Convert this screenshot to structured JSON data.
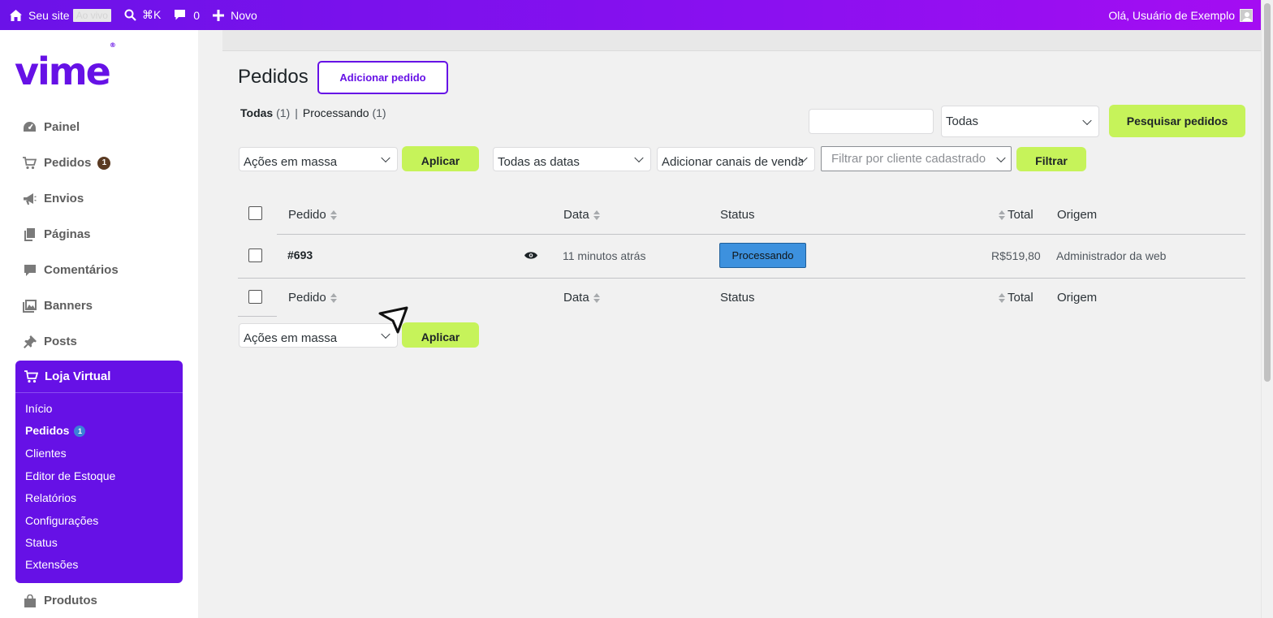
{
  "adminbar": {
    "site_label": "Seu site",
    "live_label": "Ao vivo",
    "search_shortcut": "⌘K",
    "comments_count": "0",
    "new_label": "Novo",
    "greeting": "Olá, Usuário de Exemplo"
  },
  "brand": {
    "logo": "vime",
    "registered": "®",
    "accent": "#6611e6"
  },
  "sidebar": {
    "items": [
      {
        "label": "Painel",
        "icon": "dashboard-icon"
      },
      {
        "label": "Pedidos",
        "icon": "cart-icon",
        "badge": "1"
      },
      {
        "label": "Envios",
        "icon": "megaphone-icon"
      },
      {
        "label": "Páginas",
        "icon": "pages-icon"
      },
      {
        "label": "Comentários",
        "icon": "comment-icon"
      },
      {
        "label": "Banners",
        "icon": "media-icon"
      },
      {
        "label": "Posts",
        "icon": "pin-icon"
      }
    ],
    "store": {
      "title": "Loja Virtual",
      "subitems": [
        {
          "label": "Início"
        },
        {
          "label": "Pedidos",
          "badge": "1"
        },
        {
          "label": "Clientes"
        },
        {
          "label": "Editor de Estoque"
        },
        {
          "label": "Relatórios"
        },
        {
          "label": "Configurações"
        },
        {
          "label": "Status"
        },
        {
          "label": "Extensões"
        }
      ]
    },
    "after_store": {
      "label": "Produtos",
      "icon": "bag-icon"
    }
  },
  "main": {
    "title": "Pedidos",
    "add_button": "Adicionar pedido",
    "views": {
      "all_label": "Todas",
      "all_count": "(1)",
      "separator": "|",
      "processing_label": "Processando",
      "processing_count": "(1)"
    },
    "search": {
      "value": "",
      "status_select": "Todas",
      "button": "Pesquisar pedidos"
    },
    "filters": {
      "bulk_actions": "Ações em massa",
      "apply": "Aplicar",
      "dates": "Todas as datas",
      "channels": "Adicionar canais de vendas",
      "customer_placeholder": "Filtrar por cliente cadastrado",
      "filter_button": "Filtrar"
    },
    "table": {
      "columns": {
        "order": "Pedido",
        "date": "Data",
        "status": "Status",
        "total": "Total",
        "origin": "Origem"
      },
      "rows": [
        {
          "order": "#693",
          "date": "11 minutos atrás",
          "status": "Processando",
          "total": "R$519,80",
          "origin": "Administrador da web"
        }
      ]
    },
    "bottom": {
      "bulk_actions": "Ações em massa",
      "apply": "Aplicar"
    }
  },
  "colors": {
    "adminbar_start": "#6b12e8",
    "adminbar_end": "#a40df2",
    "green_button": "#c6f35a",
    "status_processing": "#3d91de"
  }
}
